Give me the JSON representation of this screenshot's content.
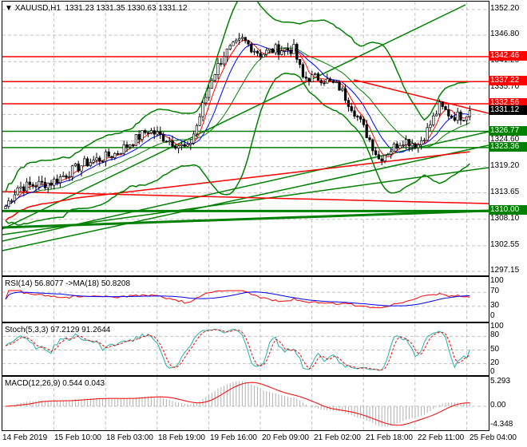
{
  "header": {
    "symbol": "XAUUSD,H1",
    "ohlc": "1331.23 1331.35 1330.63 1331.12"
  },
  "price_axis": [
    "1352.20",
    "1346.80",
    "1341.25",
    "1335.70",
    "1330.15",
    "1324.60",
    "1319.20",
    "1313.65",
    "1308.10",
    "1302.55",
    "1297.15"
  ],
  "levels": [
    {
      "label": "1342.46",
      "price": 1342.46,
      "color": "#ff0000"
    },
    {
      "label": "1337.22",
      "price": 1337.22,
      "color": "#ff0000"
    },
    {
      "label": "1332.56",
      "price": 1332.56,
      "color": "#ff0000"
    },
    {
      "label": "1326.77",
      "price": 1326.77,
      "color": "#008000"
    },
    {
      "label": "1323.36",
      "price": 1323.36,
      "color": "#008000"
    },
    {
      "label": "1310.00",
      "price": 1310.0,
      "color": "#008000"
    }
  ],
  "current_price": {
    "label": "1331.12",
    "price": 1331.12
  },
  "price_path": [
    [
      0,
      1311
    ],
    [
      4,
      1315
    ],
    [
      15,
      1316
    ],
    [
      26,
      1320
    ],
    [
      36,
      1322
    ],
    [
      47,
      1327
    ],
    [
      60,
      1323
    ],
    [
      63,
      1328
    ],
    [
      68,
      1338
    ],
    [
      72,
      1343
    ],
    [
      78,
      1346
    ],
    [
      84,
      1343
    ],
    [
      89,
      1344
    ],
    [
      95,
      1344
    ],
    [
      98,
      1338
    ],
    [
      104,
      1338
    ],
    [
      110,
      1336
    ],
    [
      115,
      1331
    ],
    [
      120,
      1325
    ],
    [
      123,
      1321
    ],
    [
      131,
      1325
    ],
    [
      136,
      1324
    ],
    [
      139,
      1327
    ],
    [
      143,
      1332
    ],
    [
      147,
      1330
    ],
    [
      151,
      1330
    ],
    [
      153,
      1331.12
    ]
  ],
  "rsi": {
    "title": "RSI(14) 56.8077  ->MA(18) 50.8208",
    "axis": [
      "100",
      "70",
      "30",
      "0"
    ]
  },
  "stoch": {
    "title": "Stoch(5,3,3) 97.2129 91.2644",
    "axis": [
      "100",
      "80",
      "50",
      "20",
      "0"
    ]
  },
  "macd": {
    "title": "MACD(12,26,9) 0.544 0.043",
    "axis": [
      "5.293",
      "0.00",
      "-4.348"
    ]
  },
  "time_axis": [
    "14 Feb 2019",
    "15 Feb 10:00",
    "18 Feb 03:00",
    "18 Feb 19:00",
    "19 Feb 16:00",
    "20 Feb 09:00",
    "21 Feb 02:00",
    "21 Feb 18:00",
    "22 Feb 11:00",
    "25 Feb 04:00"
  ],
  "colors": {
    "bull": "#008000",
    "bear": "#ff0000",
    "bands": "#008000"
  }
}
